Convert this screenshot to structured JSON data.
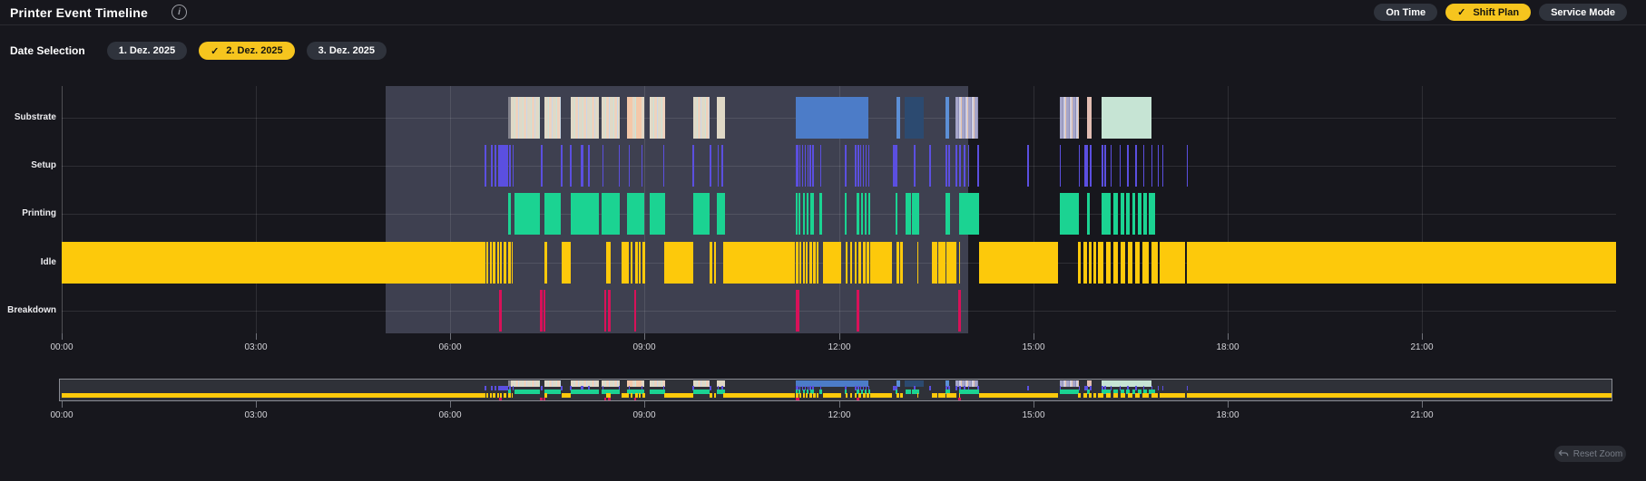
{
  "header": {
    "title": "Printer Event Timeline",
    "info_icon": "i",
    "check_glyph": "✓",
    "modes": [
      {
        "label": "On Time",
        "selected": false
      },
      {
        "label": "Shift Plan",
        "selected": true
      },
      {
        "label": "Service Mode",
        "selected": false
      }
    ]
  },
  "date_selection": {
    "label": "Date Selection",
    "options": [
      {
        "label": "1. Dez. 2025",
        "selected": false
      },
      {
        "label": "2. Dez. 2025",
        "selected": true
      },
      {
        "label": "3. Dez. 2025",
        "selected": false
      }
    ]
  },
  "footer": {
    "reset_zoom_label": "Reset Zoom"
  },
  "colors": {
    "page_bg": "#17171D",
    "accent_yellow": "#F6C51E",
    "bar_yellow": "#FDC90B",
    "bar_green": "#1BD392",
    "bar_purple": "#5B4FE0",
    "bar_red": "#D81159",
    "bar_blue": "#4C7CC8",
    "bar_navy": "#2C4A70",
    "bar_mint": "#C6E4D4",
    "shift_overlay": "rgba(152,160,200,0.30)"
  },
  "chart_data": {
    "type": "timeline-gantt",
    "title": "Printer Event Timeline",
    "rows": [
      "Substrate",
      "Setup",
      "Printing",
      "Idle",
      "Breakdown"
    ],
    "x_ticks": [
      "00:00",
      "03:00",
      "06:00",
      "09:00",
      "12:00",
      "15:00",
      "18:00",
      "21:00"
    ],
    "x_tick_hours": [
      0,
      3,
      6,
      9,
      12,
      15,
      18,
      21
    ],
    "x_range_hours": [
      0,
      24
    ],
    "shift_window_hours": [
      5,
      14
    ],
    "grid": true,
    "segments": {
      "substrate": [
        [
          6.89,
          6.93,
          "gray"
        ],
        [
          6.93,
          7.39,
          "stripA"
        ],
        [
          7.45,
          7.7,
          "stripA"
        ],
        [
          7.86,
          8.3,
          "stripA"
        ],
        [
          8.33,
          8.62,
          "stripA"
        ],
        [
          8.73,
          9.0,
          "peachStrip"
        ],
        [
          9.08,
          9.32,
          "stripA"
        ],
        [
          9.75,
          10.0,
          "stripA"
        ],
        [
          10.11,
          10.24,
          "beige"
        ],
        [
          11.34,
          12.46,
          "blue"
        ],
        [
          12.89,
          12.94,
          "blueThin"
        ],
        [
          13.01,
          13.31,
          "navy"
        ],
        [
          13.65,
          13.7,
          "blueThin"
        ],
        [
          13.8,
          14.15,
          "lavStrip"
        ],
        [
          15.41,
          15.7,
          "lavStrip"
        ],
        [
          15.83,
          15.9,
          "pink"
        ],
        [
          16.06,
          16.83,
          "mint"
        ]
      ],
      "setup": [
        [
          6.53,
          6.56
        ],
        [
          6.62,
          6.65
        ],
        [
          6.69,
          6.71
        ],
        [
          6.74,
          6.89
        ],
        [
          6.91,
          6.93
        ],
        [
          6.96,
          6.98
        ],
        [
          7.4,
          7.43
        ],
        [
          7.71,
          7.74
        ],
        [
          7.85,
          7.88
        ],
        [
          8.02,
          8.05
        ],
        [
          8.12,
          8.15
        ],
        [
          8.35,
          8.37
        ],
        [
          8.6,
          8.62
        ],
        [
          8.75,
          8.77
        ],
        [
          8.95,
          8.97
        ],
        [
          9.29,
          9.31
        ],
        [
          9.74,
          9.76
        ],
        [
          10.0,
          10.03
        ],
        [
          10.13,
          10.15
        ],
        [
          10.19,
          10.21
        ],
        [
          11.34,
          11.37
        ],
        [
          11.39,
          11.41
        ],
        [
          11.43,
          11.45
        ],
        [
          11.47,
          11.49
        ],
        [
          11.51,
          11.53
        ],
        [
          11.55,
          11.57
        ],
        [
          11.59,
          11.62
        ],
        [
          11.71,
          11.73
        ],
        [
          12.09,
          12.12
        ],
        [
          12.25,
          12.27
        ],
        [
          12.29,
          12.31
        ],
        [
          12.33,
          12.35
        ],
        [
          12.37,
          12.39
        ],
        [
          12.41,
          12.43
        ],
        [
          12.45,
          12.47
        ],
        [
          12.84,
          12.9
        ],
        [
          13.16,
          13.18
        ],
        [
          13.4,
          13.42
        ],
        [
          13.65,
          13.67
        ],
        [
          13.69,
          13.71
        ],
        [
          13.8,
          13.83
        ],
        [
          13.86,
          13.88
        ],
        [
          13.93,
          13.95
        ],
        [
          13.99,
          14.01
        ],
        [
          14.14,
          14.16
        ],
        [
          14.91,
          14.93
        ],
        [
          15.41,
          15.43
        ],
        [
          15.7,
          15.72
        ],
        [
          15.79,
          15.85
        ],
        [
          15.88,
          15.9
        ],
        [
          16.06,
          16.08
        ],
        [
          16.1,
          16.12
        ],
        [
          16.19,
          16.21
        ],
        [
          16.33,
          16.35
        ],
        [
          16.45,
          16.47
        ],
        [
          16.58,
          16.6
        ],
        [
          16.7,
          16.72
        ],
        [
          16.82,
          16.84
        ],
        [
          16.92,
          16.94
        ],
        [
          16.99,
          17.01
        ],
        [
          17.37,
          17.39
        ]
      ],
      "printing": [
        [
          6.89,
          6.93
        ],
        [
          6.99,
          7.39
        ],
        [
          7.45,
          7.7
        ],
        [
          7.86,
          8.3
        ],
        [
          8.33,
          8.62
        ],
        [
          8.73,
          9.0
        ],
        [
          9.08,
          9.32
        ],
        [
          9.75,
          10.0
        ],
        [
          10.11,
          10.24
        ],
        [
          11.33,
          11.36
        ],
        [
          11.38,
          11.41
        ],
        [
          11.44,
          11.47
        ],
        [
          11.5,
          11.53
        ],
        [
          11.56,
          11.62
        ],
        [
          11.7,
          11.74
        ],
        [
          12.09,
          12.12
        ],
        [
          12.28,
          12.31
        ],
        [
          12.34,
          12.37
        ],
        [
          12.4,
          12.43
        ],
        [
          12.46,
          12.49
        ],
        [
          12.88,
          12.91
        ],
        [
          13.03,
          13.12
        ],
        [
          13.13,
          13.24
        ],
        [
          13.65,
          13.71
        ],
        [
          13.86,
          14.16
        ],
        [
          15.41,
          15.7
        ],
        [
          15.83,
          15.87
        ],
        [
          16.06,
          16.2
        ],
        [
          16.24,
          16.31
        ],
        [
          16.35,
          16.4
        ],
        [
          16.44,
          16.49
        ],
        [
          16.53,
          16.58
        ],
        [
          16.62,
          16.67
        ],
        [
          16.7,
          16.76
        ],
        [
          16.79,
          16.88
        ]
      ],
      "idle": [
        [
          0.0,
          6.54
        ],
        [
          6.56,
          6.59
        ],
        [
          6.61,
          6.64
        ],
        [
          6.66,
          6.7
        ],
        [
          6.72,
          6.75
        ],
        [
          6.77,
          6.8
        ],
        [
          6.82,
          6.86
        ],
        [
          6.9,
          6.93
        ],
        [
          6.95,
          6.97
        ],
        [
          7.45,
          7.49
        ],
        [
          7.72,
          7.86
        ],
        [
          8.41,
          8.48
        ],
        [
          8.65,
          8.76
        ],
        [
          8.78,
          8.81
        ],
        [
          8.86,
          8.89
        ],
        [
          8.91,
          8.94
        ],
        [
          8.96,
          9.01
        ],
        [
          9.3,
          9.75
        ],
        [
          10.01,
          10.05
        ],
        [
          10.07,
          10.1
        ],
        [
          10.21,
          11.32
        ],
        [
          11.34,
          11.37
        ],
        [
          11.39,
          11.42
        ],
        [
          11.44,
          11.47
        ],
        [
          11.49,
          11.52
        ],
        [
          11.54,
          11.58
        ],
        [
          11.6,
          11.64
        ],
        [
          11.66,
          11.69
        ],
        [
          11.76,
          12.04
        ],
        [
          12.1,
          12.14
        ],
        [
          12.17,
          12.21
        ],
        [
          12.24,
          12.27
        ],
        [
          12.3,
          12.34
        ],
        [
          12.37,
          12.41
        ],
        [
          12.43,
          12.47
        ],
        [
          12.49,
          12.82
        ],
        [
          12.89,
          12.93
        ],
        [
          12.95,
          12.99
        ],
        [
          13.21,
          13.23
        ],
        [
          13.44,
          13.52
        ],
        [
          13.54,
          13.64
        ],
        [
          13.66,
          13.82
        ],
        [
          13.85,
          13.87
        ],
        [
          14.16,
          15.39
        ],
        [
          15.69,
          15.74
        ],
        [
          15.77,
          15.83
        ],
        [
          15.86,
          15.9
        ],
        [
          15.93,
          15.97
        ],
        [
          16.0,
          16.08
        ],
        [
          16.12,
          16.2
        ],
        [
          16.24,
          16.31
        ],
        [
          16.35,
          16.42
        ],
        [
          16.46,
          16.53
        ],
        [
          16.57,
          16.64
        ],
        [
          16.68,
          16.78
        ],
        [
          16.82,
          16.93
        ],
        [
          16.95,
          17.34
        ],
        [
          17.37,
          24.0
        ]
      ],
      "breakdown": [
        [
          6.76,
          6.8
        ],
        [
          7.39,
          7.42
        ],
        [
          7.44,
          7.47
        ],
        [
          8.38,
          8.41
        ],
        [
          8.44,
          8.47
        ],
        [
          8.84,
          8.87
        ],
        [
          11.33,
          11.39
        ],
        [
          12.27,
          12.31
        ],
        [
          13.84,
          13.89
        ]
      ]
    }
  }
}
